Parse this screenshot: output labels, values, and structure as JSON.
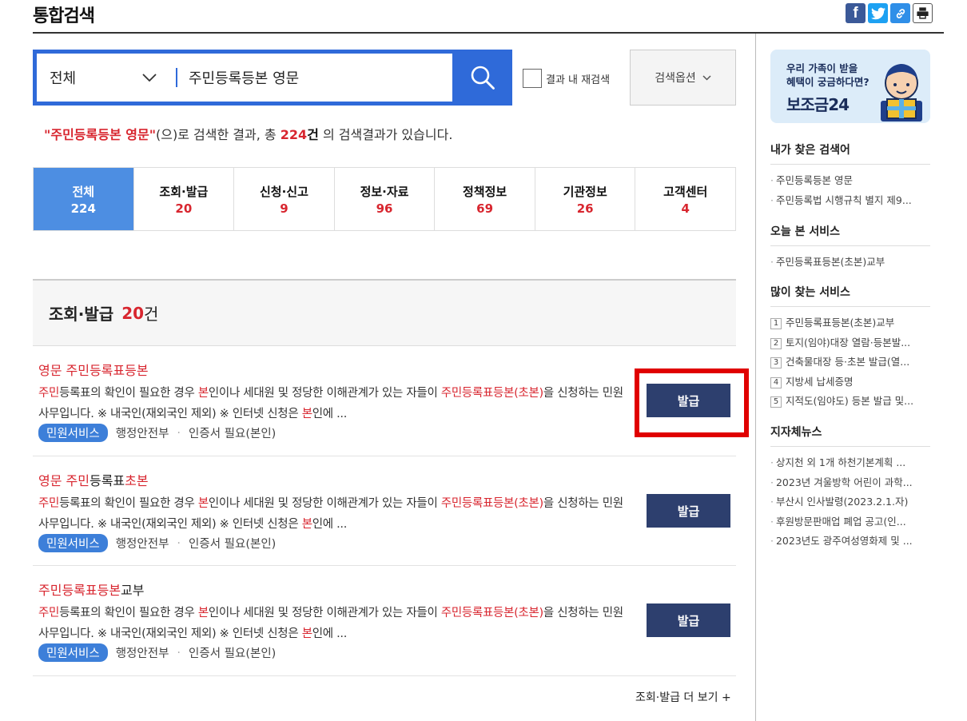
{
  "page": {
    "title": "통합검색"
  },
  "share": {
    "facebook_glyph": "f"
  },
  "search": {
    "scope": "전체",
    "query": "주민등록등본 영문",
    "recheck_label": "결과 내 재검색",
    "options_label": "검색옵션"
  },
  "summary": {
    "open_quote": "\"",
    "query": "주민등록등본 영문",
    "close_quote": "\"",
    "after_query": "(으)로 검색한 결과, 총 ",
    "count": "224",
    "unit": "건",
    "tail": " 의 검색결과가 있습니다."
  },
  "tabs": [
    {
      "label": "전체",
      "count": "224"
    },
    {
      "label": "조회·발급",
      "count": "20"
    },
    {
      "label": "신청·신고",
      "count": "9"
    },
    {
      "label": "정보·자료",
      "count": "96"
    },
    {
      "label": "정책정보",
      "count": "69"
    },
    {
      "label": "기관정보",
      "count": "26"
    },
    {
      "label": "고객센터",
      "count": "4"
    }
  ],
  "section": {
    "title": "조회·발급",
    "count": "20",
    "unit": "건",
    "more": "조회·발급 더 보기  +"
  },
  "results": [
    {
      "title_parts": [
        "영문 주민등록표등본"
      ],
      "desc_parts": [
        "주민",
        "등록표의 확인이 필요한 경우 ",
        "본",
        "인이나 세대원 및 정당한 이해관계가 있는 자들이 ",
        "주민등록표등본(초본)",
        "을 신청하는 민원사무입니다. ※ 내국인(재외국인 제외) ※ 인터넷 신청은 ",
        "본",
        "인에 ..."
      ],
      "badge": "민원서비스",
      "org": "행정안전부",
      "cert": "인증서 필요(본인)",
      "button": "발급"
    },
    {
      "title_parts": [
        "영문 주민",
        "등록표",
        "초본"
      ],
      "desc_parts": [
        "주민",
        "등록표의 확인이 필요한 경우 ",
        "본",
        "인이나 세대원 및 정당한 이해관계가 있는 자들이 ",
        "주민등록표등본(초본)",
        "을 신청하는 민원사무입니다. ※ 내국인(재외국인 제외) ※ 인터넷 신청은 ",
        "본",
        "인에 ..."
      ],
      "badge": "민원서비스",
      "org": "행정안전부",
      "cert": "인증서 필요(본인)",
      "button": "발급"
    },
    {
      "title_parts": [
        "주민등록표등본",
        "교부"
      ],
      "desc_parts": [
        "주민",
        "등록표의 확인이 필요한 경우 ",
        "본",
        "인이나 세대원 및 정당한 이해관계가 있는 자들이 ",
        "주민등록표등본(초본)",
        "을 신청하는 민원사무입니다. ※ 내국인(재외국인 제외) ※ 인터넷 신청은 ",
        "본",
        "인에 ..."
      ],
      "badge": "민원서비스",
      "org": "행정안전부",
      "cert": "인증서 필요(본인)",
      "button": "발급"
    }
  ],
  "sidebar": {
    "banner": {
      "line1": "우리 가족이 받을",
      "line2": "혜택이 궁금하다면?",
      "big": "보조금24"
    },
    "my_searches": {
      "title": "내가 찾은 검색어",
      "items": [
        "주민등록등본 영문",
        "주민등록법 시행규칙 별지 제9..."
      ]
    },
    "today_services": {
      "title": "오늘 본 서비스",
      "items": [
        "주민등록표등본(초본)교부"
      ]
    },
    "popular": {
      "title": "많이 찾는 서비스",
      "items": [
        {
          "rank": "1",
          "label": "주민등록표등본(초본)교부"
        },
        {
          "rank": "2",
          "label": "토지(임야)대장 열람·등본발..."
        },
        {
          "rank": "3",
          "label": "건축물대장 등·초본 발급(열..."
        },
        {
          "rank": "4",
          "label": "지방세 납세증명"
        },
        {
          "rank": "5",
          "label": "지적도(임야도) 등본 발급 및..."
        }
      ]
    },
    "news": {
      "title": "지자체뉴스",
      "items": [
        "상지천 외 1개 하천기본계획 ...",
        "2023년 겨울방학 어린이 과학...",
        "부산시 인사발령(2023.2.1.자)",
        "후원방문판매업 폐업 공고(인...",
        "2023년도 광주여성영화제 및 ..."
      ]
    }
  }
}
